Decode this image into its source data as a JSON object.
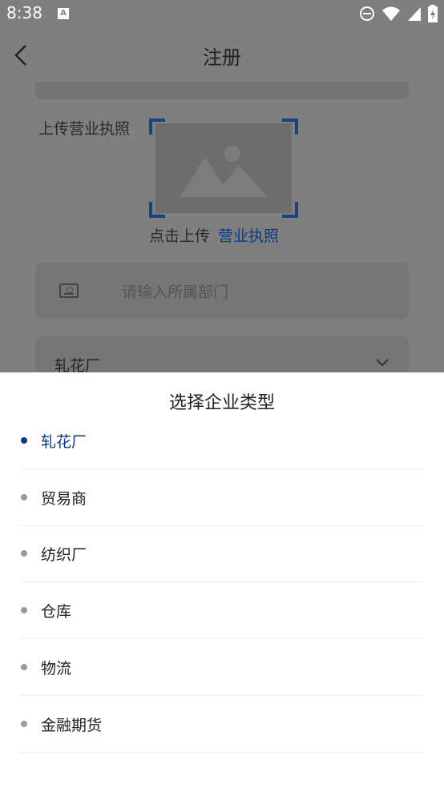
{
  "status_bar": {
    "time": "8:38",
    "notif_badge": "A"
  },
  "header": {
    "title": "注册"
  },
  "form": {
    "upload_label": "上传营业执照",
    "upload_hint_prefix": "点击上传",
    "upload_hint_link": "营业执照",
    "department_placeholder": "请输入所属部门",
    "enterprise_type_value": "轧花厂"
  },
  "sheet": {
    "title": "选择企业类型",
    "options": [
      {
        "label": "轧花厂",
        "selected": true
      },
      {
        "label": "贸易商",
        "selected": false
      },
      {
        "label": "纺织厂",
        "selected": false
      },
      {
        "label": "仓库",
        "selected": false
      },
      {
        "label": "物流",
        "selected": false
      },
      {
        "label": "金融期货",
        "selected": false
      }
    ]
  },
  "colors": {
    "accent": "#0a3a80",
    "overlay": "#7f7f7f",
    "divider": "#eeeeee"
  }
}
